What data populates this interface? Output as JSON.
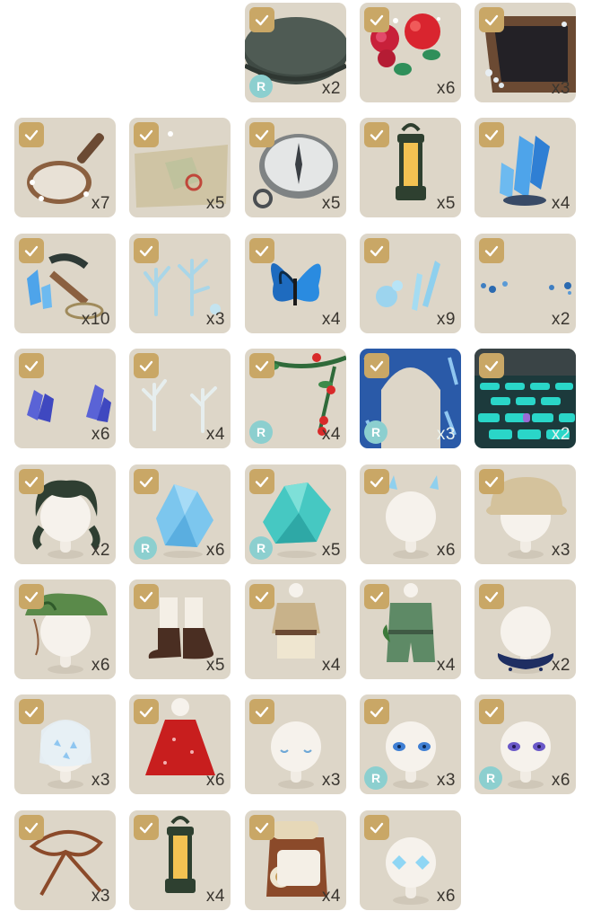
{
  "items": [
    {
      "count": "",
      "checked": false,
      "rare": false,
      "icon": "blank",
      "blank": true
    },
    {
      "count": "",
      "checked": false,
      "rare": false,
      "icon": "blank",
      "blank": true
    },
    {
      "count": "x2",
      "checked": true,
      "rare": true,
      "icon": "stone-platform"
    },
    {
      "count": "x6",
      "checked": true,
      "rare": false,
      "icon": "red-flowers"
    },
    {
      "count": "x3",
      "checked": true,
      "rare": false,
      "icon": "wooden-frame"
    },
    {
      "count": "x7",
      "checked": true,
      "rare": false,
      "icon": "magnifying-glass"
    },
    {
      "count": "x5",
      "checked": true,
      "rare": false,
      "icon": "treasure-map"
    },
    {
      "count": "x5",
      "checked": true,
      "rare": false,
      "icon": "compass"
    },
    {
      "count": "x5",
      "checked": true,
      "rare": false,
      "icon": "lantern"
    },
    {
      "count": "x4",
      "checked": true,
      "rare": false,
      "icon": "blue-crystal"
    },
    {
      "count": "x10",
      "checked": true,
      "rare": false,
      "icon": "pickaxe-crystals"
    },
    {
      "count": "x3",
      "checked": true,
      "rare": false,
      "icon": "ice-coral"
    },
    {
      "count": "x4",
      "checked": true,
      "rare": false,
      "icon": "blue-butterfly"
    },
    {
      "count": "x9",
      "checked": true,
      "rare": false,
      "icon": "ice-crystal-sprigs"
    },
    {
      "count": "x2",
      "checked": true,
      "rare": false,
      "icon": "blue-sparkles"
    },
    {
      "count": "x6",
      "checked": true,
      "rare": false,
      "icon": "purple-crystals"
    },
    {
      "count": "x4",
      "checked": true,
      "rare": false,
      "icon": "white-coral"
    },
    {
      "count": "x4",
      "checked": true,
      "rare": true,
      "icon": "berry-garland"
    },
    {
      "count": "x3",
      "checked": true,
      "rare": true,
      "icon": "crystal-arch",
      "light": true
    },
    {
      "count": "x2",
      "checked": true,
      "rare": false,
      "icon": "glowing-brick-floor",
      "light": true
    },
    {
      "count": "x2",
      "checked": true,
      "rare": false,
      "icon": "dark-messy-hair"
    },
    {
      "count": "x6",
      "checked": true,
      "rare": true,
      "icon": "ice-crystal-cluster"
    },
    {
      "count": "x5",
      "checked": true,
      "rare": true,
      "icon": "teal-crystal-cluster"
    },
    {
      "count": "x6",
      "checked": true,
      "rare": false,
      "icon": "crystal-hair-clips"
    },
    {
      "count": "x3",
      "checked": true,
      "rare": false,
      "icon": "bucket-hat"
    },
    {
      "count": "x6",
      "checked": true,
      "rare": false,
      "icon": "green-leaf-hat"
    },
    {
      "count": "x5",
      "checked": true,
      "rare": false,
      "icon": "brown-boots"
    },
    {
      "count": "x4",
      "checked": true,
      "rare": false,
      "icon": "explorer-outfit"
    },
    {
      "count": "x4",
      "checked": true,
      "rare": false,
      "icon": "green-jumpsuit"
    },
    {
      "count": "x2",
      "checked": true,
      "rare": false,
      "icon": "navy-scarf"
    },
    {
      "count": "x3",
      "checked": true,
      "rare": false,
      "icon": "crystal-veil"
    },
    {
      "count": "x6",
      "checked": true,
      "rare": false,
      "icon": "red-dress"
    },
    {
      "count": "x3",
      "checked": true,
      "rare": false,
      "icon": "blue-tears-face"
    },
    {
      "count": "x3",
      "checked": true,
      "rare": true,
      "icon": "blue-eyes"
    },
    {
      "count": "x6",
      "checked": true,
      "rare": true,
      "icon": "purple-eyes"
    },
    {
      "count": "x3",
      "checked": true,
      "rare": false,
      "icon": "rope-coil"
    },
    {
      "count": "x4",
      "checked": true,
      "rare": false,
      "icon": "lantern"
    },
    {
      "count": "x4",
      "checked": true,
      "rare": false,
      "icon": "explorer-backpack"
    },
    {
      "count": "x6",
      "checked": true,
      "rare": false,
      "icon": "crystal-eye-stickers"
    }
  ],
  "rare_label": "R",
  "colors": {
    "tile_bg": "#ddd6c8",
    "check_bg": "#c9a766",
    "rare_badge": "#8ccfcf",
    "count_text": "#3a3630"
  }
}
